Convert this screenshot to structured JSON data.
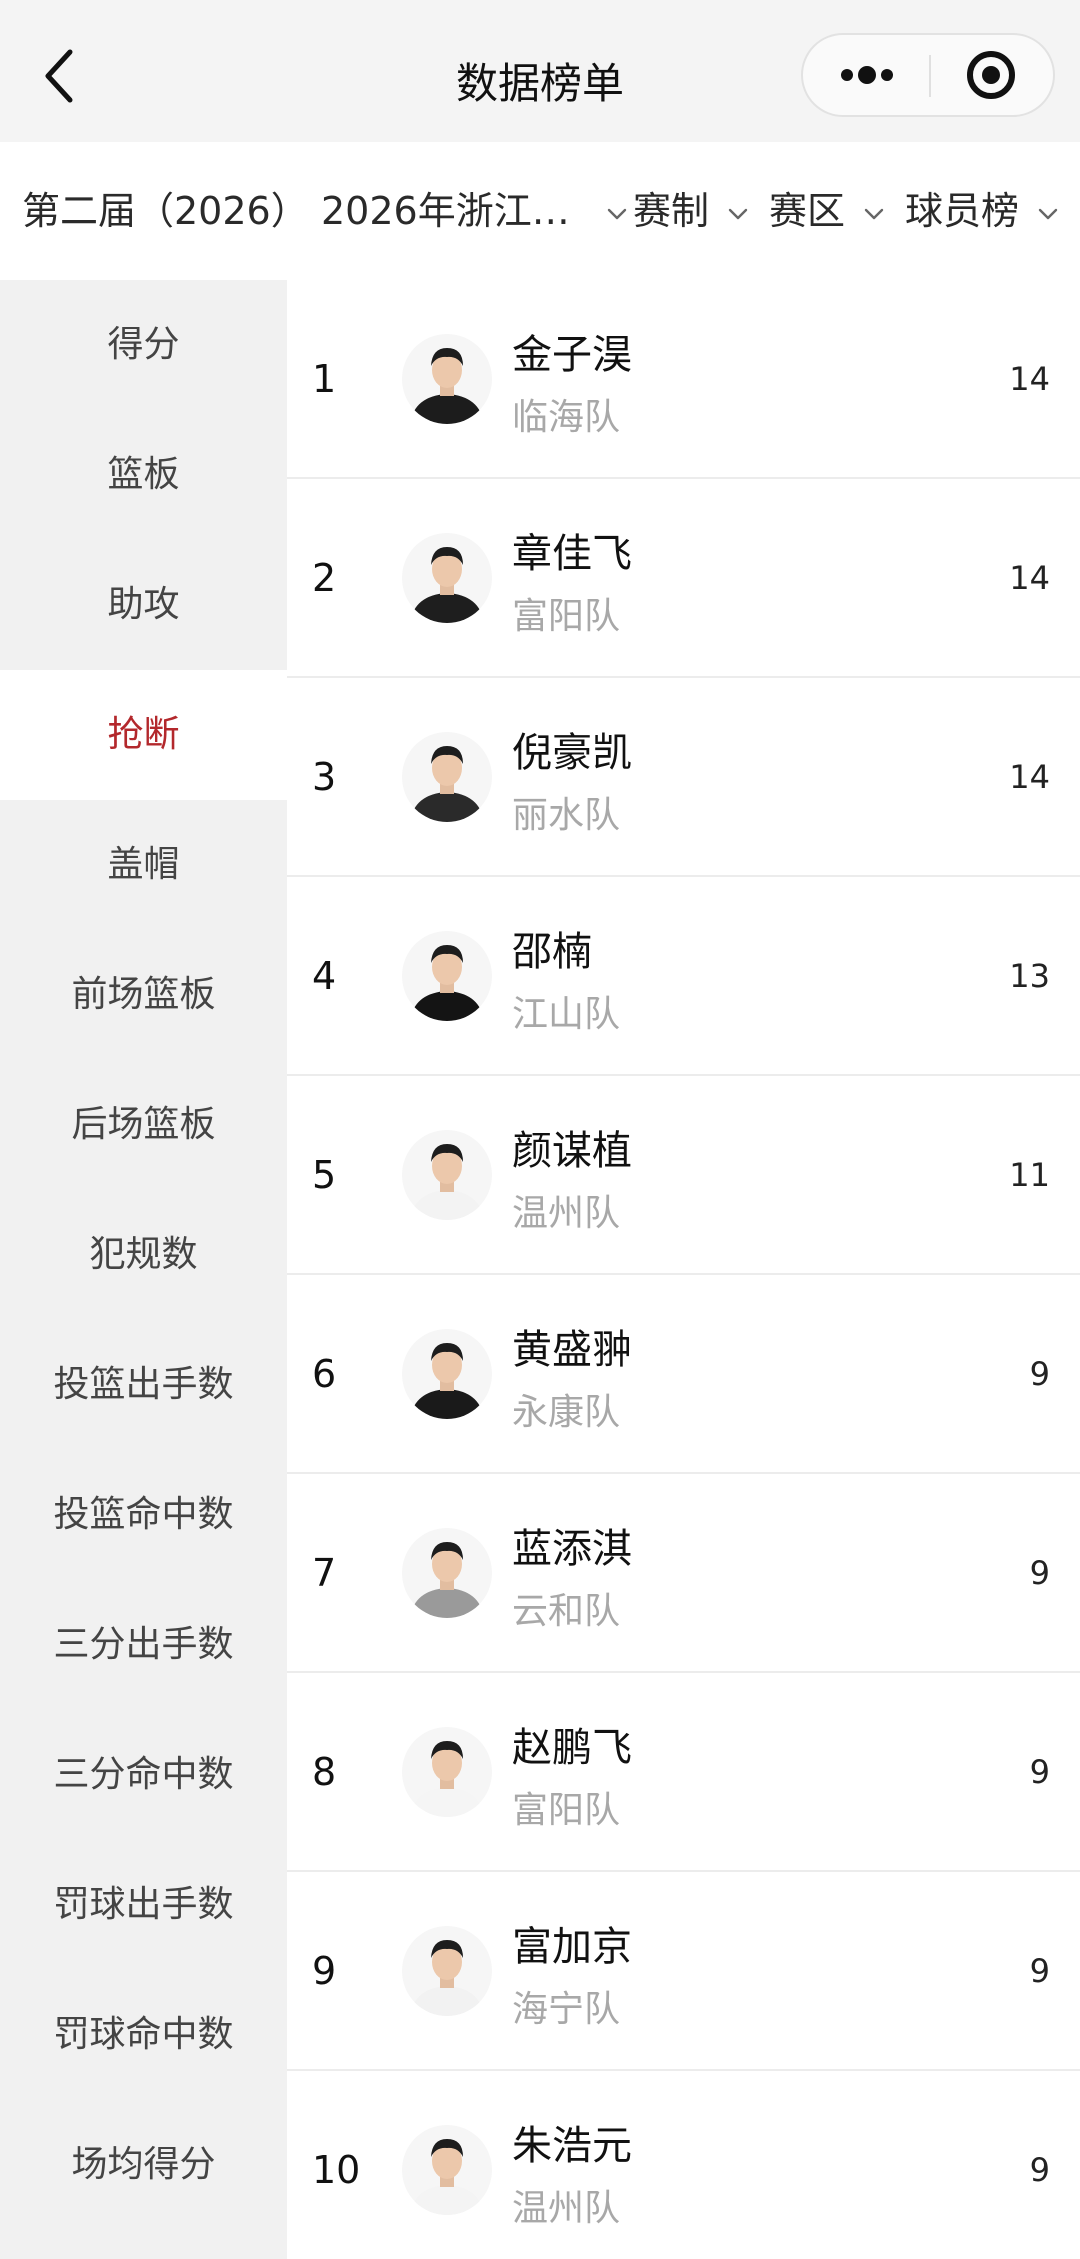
{
  "nav": {
    "title": "数据榜单"
  },
  "filters": [
    {
      "label": "第二届（2026）"
    },
    {
      "label": "2026年浙江…"
    },
    {
      "label": "赛制"
    },
    {
      "label": "赛区"
    },
    {
      "label": "球员榜"
    }
  ],
  "categories": [
    "得分",
    "篮板",
    "助攻",
    "抢断",
    "盖帽",
    "前场篮板",
    "后场篮板",
    "犯规数",
    "投篮出手数",
    "投篮命中数",
    "三分出手数",
    "三分命中数",
    "罚球出手数",
    "罚球命中数",
    "场均得分"
  ],
  "active_category": "抢断",
  "colors": {
    "accent": "#b3282c",
    "sidebar_bg": "#f1f1f1",
    "team_text": "#a8a8a8"
  },
  "players": [
    {
      "rank": "1",
      "name": "金子淏",
      "team": "临海队",
      "value": "14",
      "shirt": "#1c1c1c"
    },
    {
      "rank": "2",
      "name": "章佳飞",
      "team": "富阳队",
      "value": "14",
      "shirt": "#1e1e1e"
    },
    {
      "rank": "3",
      "name": "倪豪凯",
      "team": "丽水队",
      "value": "14",
      "shirt": "#2a2a2a"
    },
    {
      "rank": "4",
      "name": "邵楠",
      "team": "江山队",
      "value": "13",
      "shirt": "#141414"
    },
    {
      "rank": "5",
      "name": "颜谋植",
      "team": "温州队",
      "value": "11",
      "shirt": "#f3f3f3"
    },
    {
      "rank": "6",
      "name": "黄盛翀",
      "team": "永康队",
      "value": "9",
      "shirt": "#1a1a1a"
    },
    {
      "rank": "7",
      "name": "蓝添淇",
      "team": "云和队",
      "value": "9",
      "shirt": "#9a9a9a"
    },
    {
      "rank": "8",
      "name": "赵鹏飞",
      "team": "富阳队",
      "value": "9",
      "shirt": "#f5f5f5"
    },
    {
      "rank": "9",
      "name": "富加京",
      "team": "海宁队",
      "value": "9",
      "shirt": "#f2f2f2"
    },
    {
      "rank": "10",
      "name": "朱浩元",
      "team": "温州队",
      "value": "9",
      "shirt": "#f4f4f4"
    }
  ]
}
